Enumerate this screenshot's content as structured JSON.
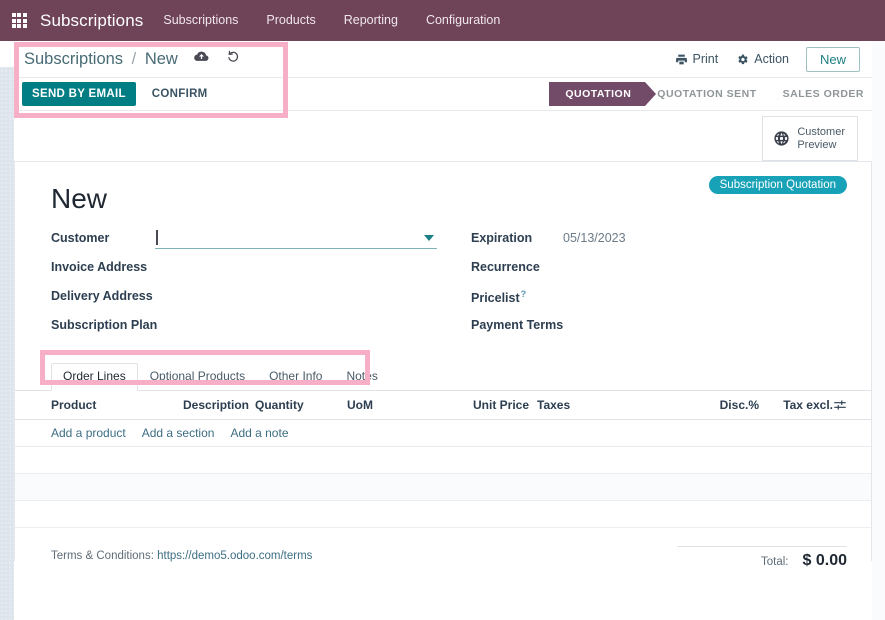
{
  "navbar": {
    "apps_icon": "grid-apps-icon",
    "brand": "Subscriptions",
    "menus": [
      "Subscriptions",
      "Products",
      "Reporting",
      "Configuration"
    ]
  },
  "control_panel": {
    "breadcrumb": {
      "root": "Subscriptions",
      "separator": "/",
      "current": "New"
    },
    "save_icon": "cloud-upload-icon",
    "discard_icon": "undo-icon",
    "print_label": "Print",
    "print_icon": "printer-icon",
    "action_label": "Action",
    "action_icon": "gear-icon",
    "new_label": "New"
  },
  "statusbar": {
    "stages": [
      {
        "label": "QUOTATION",
        "active": true
      },
      {
        "label": "QUOTATION SENT",
        "active": false
      },
      {
        "label": "SALES ORDER",
        "active": false
      }
    ]
  },
  "action_buttons": {
    "primary": "SEND BY EMAIL",
    "secondary": "CONFIRM"
  },
  "smart_button": {
    "icon": "globe-icon",
    "line1": "Customer",
    "line2": "Preview"
  },
  "record": {
    "title": "New",
    "badge": "Subscription Quotation"
  },
  "form": {
    "left": [
      {
        "label": "Customer",
        "value": "",
        "widget": "many2one-input"
      },
      {
        "label": "Invoice Address",
        "value": "",
        "widget": "text"
      },
      {
        "label": "Delivery Address",
        "value": "",
        "widget": "text"
      },
      {
        "label": "Subscription Plan",
        "value": "",
        "widget": "text"
      }
    ],
    "right": [
      {
        "label": "Expiration",
        "value": "05/13/2023",
        "widget": "date"
      },
      {
        "label": "Recurrence",
        "value": "",
        "widget": "text"
      },
      {
        "label": "Pricelist",
        "value": "",
        "widget": "text",
        "help": "?"
      },
      {
        "label": "Payment Terms",
        "value": "",
        "widget": "text"
      }
    ]
  },
  "notebook": {
    "tabs": [
      {
        "label": "Order Lines",
        "active": true
      },
      {
        "label": "Optional Products",
        "active": false
      },
      {
        "label": "Other Info",
        "active": false
      },
      {
        "label": "Notes",
        "active": false
      }
    ]
  },
  "order_lines": {
    "columns": [
      "Product",
      "Description",
      "Quantity",
      "UoM",
      "Unit Price",
      "Taxes",
      "Disc.%",
      "Tax excl."
    ],
    "optional_columns_icon": "sliders-icon",
    "add_links": [
      "Add a product",
      "Add a section",
      "Add a note"
    ],
    "rows": []
  },
  "footer": {
    "terms_label": "Terms & Conditions:",
    "terms_url": "https://demo5.odoo.com/terms",
    "total_label": "Total:",
    "total_value": "$ 0.00"
  },
  "colors": {
    "navbar_purple": "#6f4459",
    "stage_purple": "#714b67",
    "primary_teal": "#017e84",
    "badge_teal": "#18a2b8",
    "highlight_pink": "#f7afc8",
    "link_blue": "#3d6e84"
  }
}
